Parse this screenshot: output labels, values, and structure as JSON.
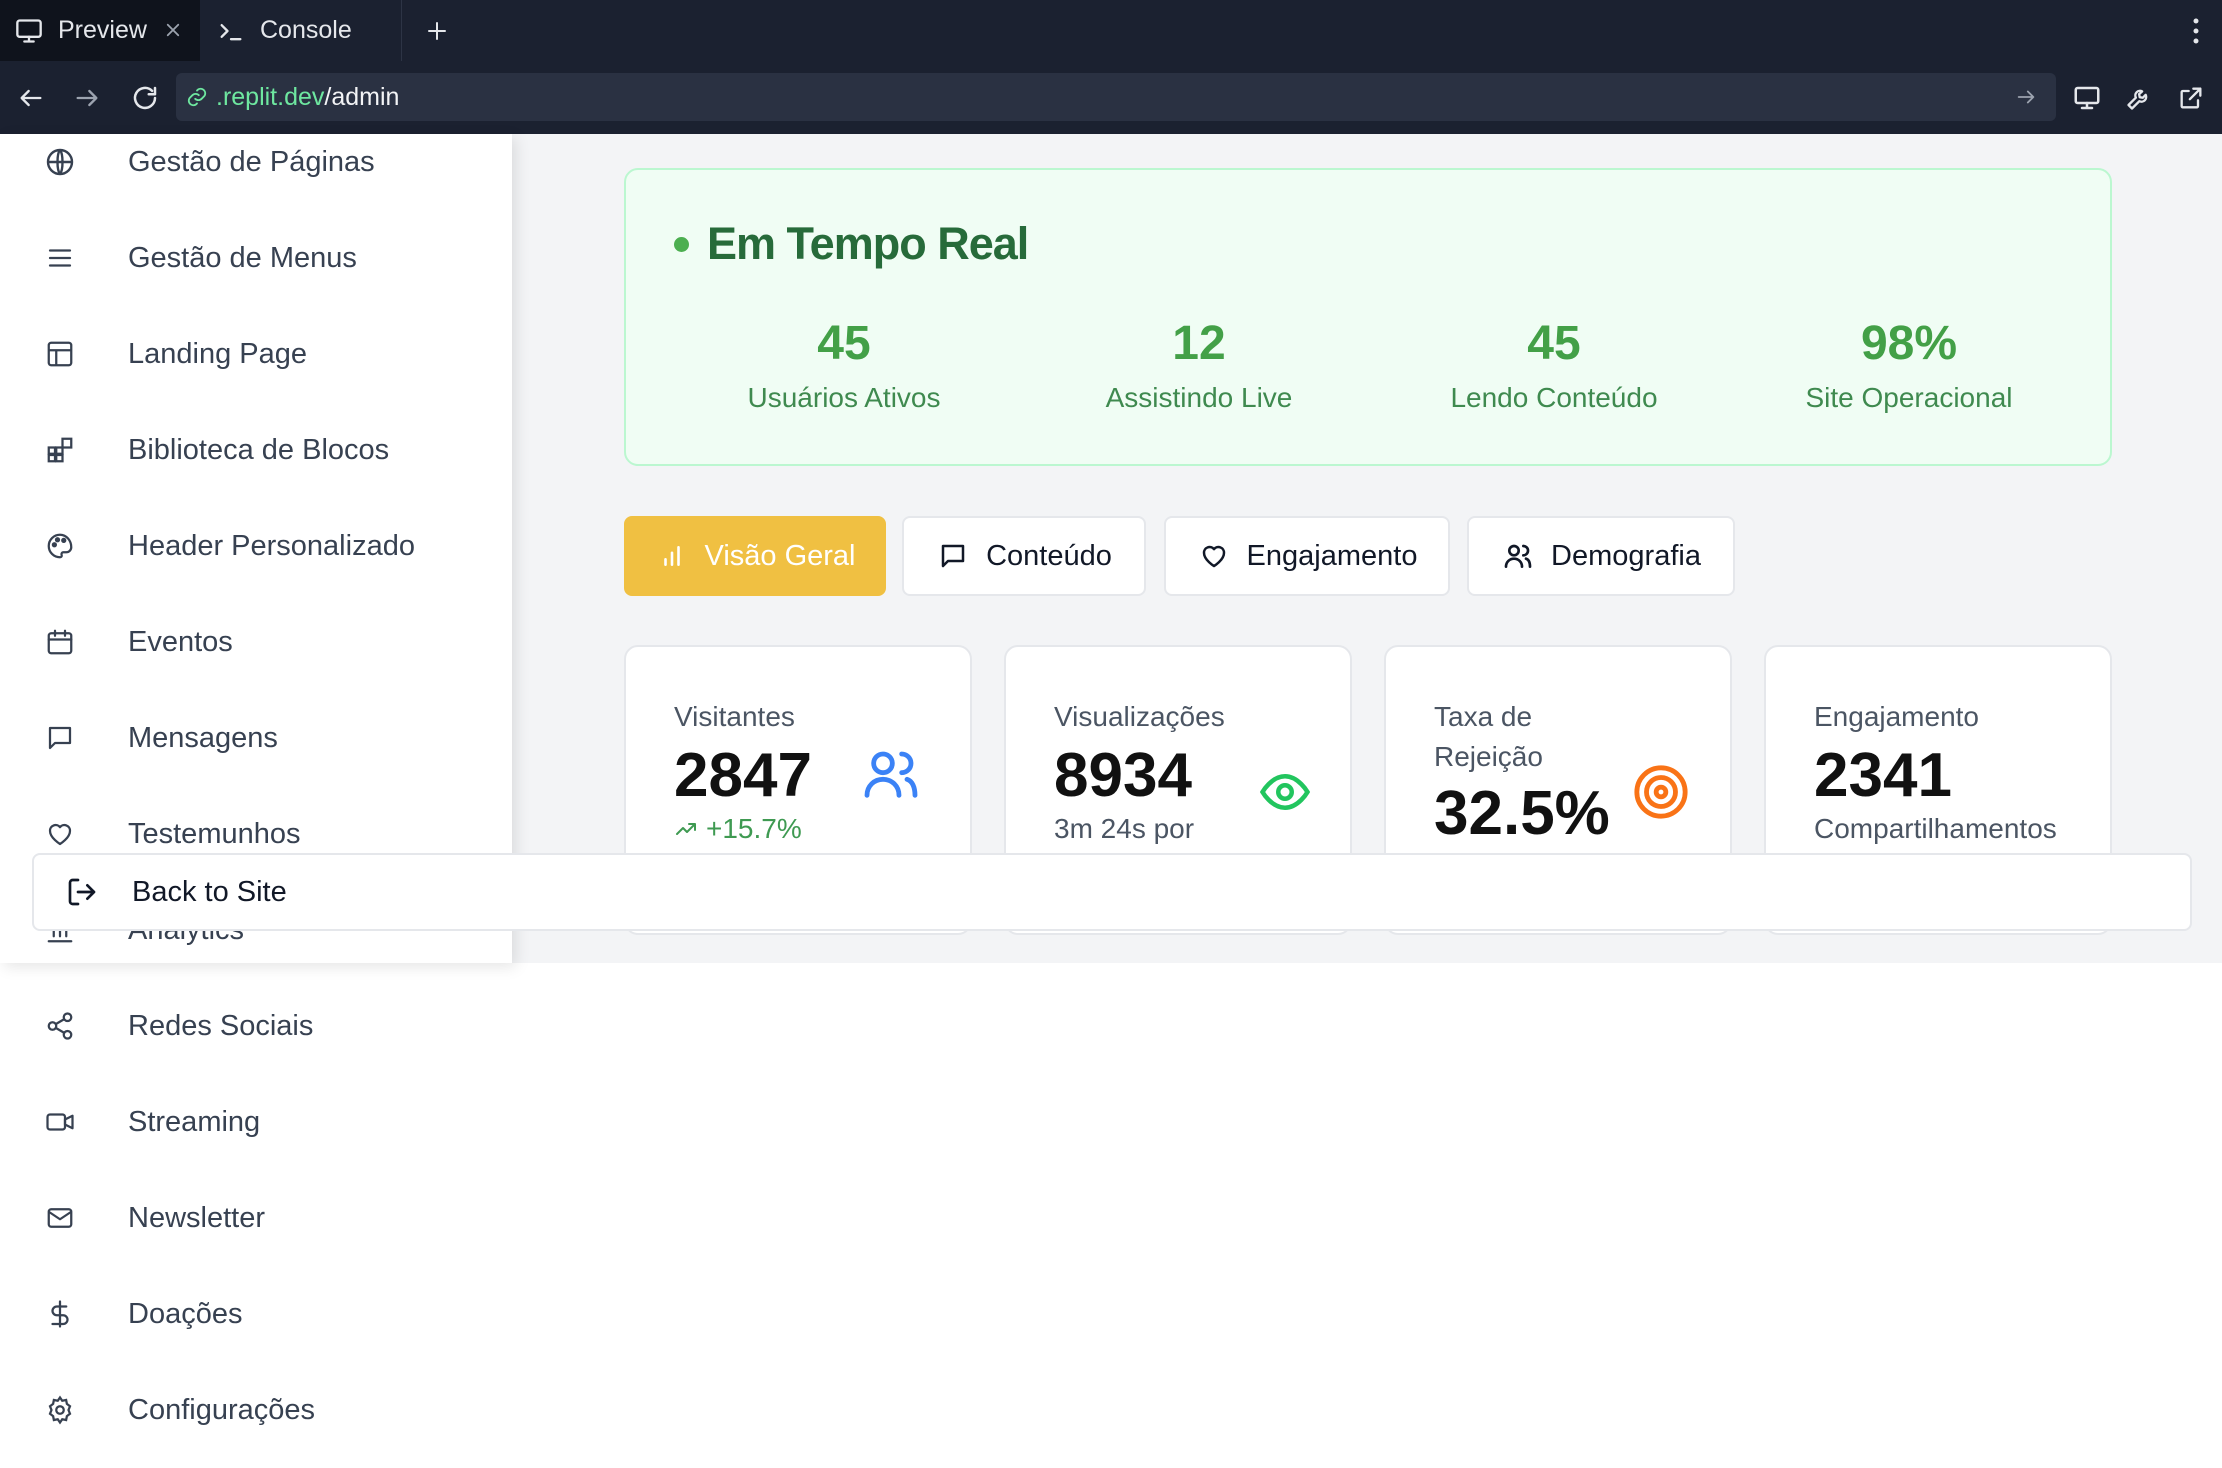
{
  "browser": {
    "tabs": [
      {
        "label": "Preview",
        "icon": "monitor-icon"
      },
      {
        "label": "Console",
        "icon": "terminal-icon"
      }
    ],
    "url_domain": ".replit.dev",
    "url_path": "/admin"
  },
  "sidebar": {
    "items": [
      {
        "label": "Gestão de Páginas",
        "icon": "globe-icon"
      },
      {
        "label": "Gestão de Menus",
        "icon": "menu-icon"
      },
      {
        "label": "Landing Page",
        "icon": "layout-icon"
      },
      {
        "label": "Biblioteca de Blocos",
        "icon": "blocks-icon"
      },
      {
        "label": "Header Personalizado",
        "icon": "palette-icon"
      },
      {
        "label": "Eventos",
        "icon": "calendar-icon"
      },
      {
        "label": "Mensagens",
        "icon": "message-icon"
      },
      {
        "label": "Testemunhos",
        "icon": "heart-icon"
      },
      {
        "label": "Analytics",
        "icon": "bar-chart-icon"
      },
      {
        "label": "Redes Sociais",
        "icon": "share-icon"
      },
      {
        "label": "Streaming",
        "icon": "video-icon"
      },
      {
        "label": "Newsletter",
        "icon": "mail-icon"
      },
      {
        "label": "Doações",
        "icon": "dollar-icon"
      },
      {
        "label": "Configurações",
        "icon": "settings-icon"
      }
    ],
    "back_to_site": "Back to Site"
  },
  "realtime": {
    "title": "Em Tempo Real",
    "stats": [
      {
        "value": "45",
        "label": "Usuários Ativos"
      },
      {
        "value": "12",
        "label": "Assistindo Live"
      },
      {
        "value": "45",
        "label": "Lendo Conteúdo"
      },
      {
        "value": "98%",
        "label": "Site Operacional"
      }
    ]
  },
  "tabs": [
    {
      "label": "Visão Geral",
      "icon": "bar-chart-icon",
      "active": true
    },
    {
      "label": "Conteúdo",
      "icon": "message-icon",
      "active": false
    },
    {
      "label": "Engajamento",
      "icon": "heart-icon",
      "active": false
    },
    {
      "label": "Demografia",
      "icon": "users-icon",
      "active": false
    }
  ],
  "metrics": [
    {
      "label": "Visitantes",
      "value": "2847",
      "sub": "+15.7%",
      "icon": "users-icon",
      "color": "#3b82f6"
    },
    {
      "label": "Visualizações",
      "value": "8934",
      "sub": "3m 24s por",
      "icon": "eye-icon",
      "color": "#22c55e"
    },
    {
      "label": "Taxa de Rejeição",
      "value": "32.5%",
      "sub": "",
      "icon": "target-icon",
      "color": "#f97316"
    },
    {
      "label": "Engajamento",
      "value": "2341",
      "sub": "Compartilhamentos",
      "icon": "share-icon",
      "color": "#6b7280"
    }
  ],
  "colors": {
    "chrome_bg": "#1b2130",
    "url_domain": "#6ee7a0",
    "realtime_green": "#43a047",
    "active_tab": "#f0c042"
  }
}
